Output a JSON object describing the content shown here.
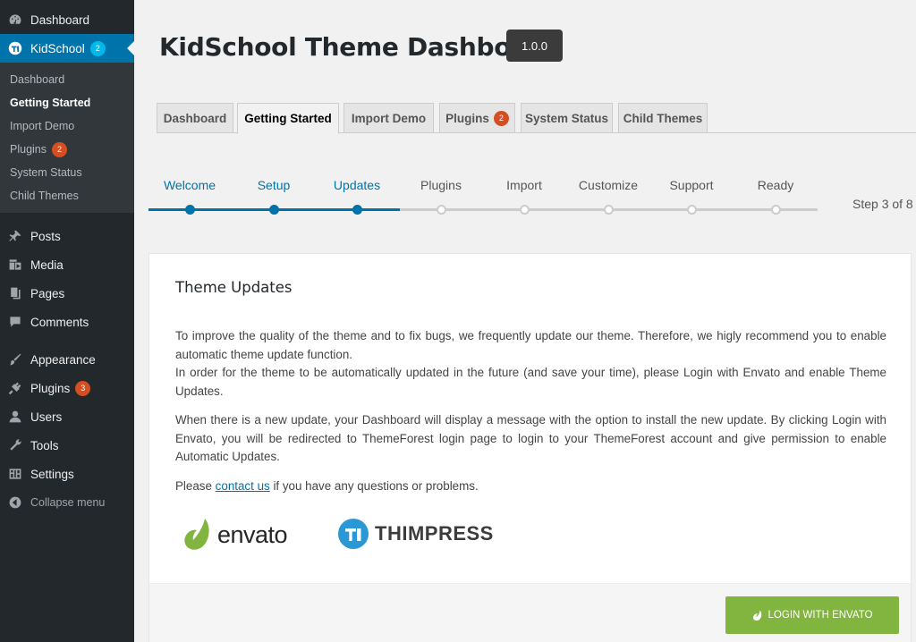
{
  "sidebar": {
    "items": [
      {
        "label": "Dashboard",
        "icon": "dashboard-icon"
      },
      {
        "label": "KidSchool",
        "icon": "thimpress-icon",
        "badge": "2"
      },
      {
        "label": "Posts",
        "icon": "pin-icon"
      },
      {
        "label": "Media",
        "icon": "media-icon"
      },
      {
        "label": "Pages",
        "icon": "pages-icon"
      },
      {
        "label": "Comments",
        "icon": "comments-icon"
      },
      {
        "label": "Appearance",
        "icon": "brush-icon"
      },
      {
        "label": "Plugins",
        "icon": "plugins-icon",
        "badge": "3"
      },
      {
        "label": "Users",
        "icon": "users-icon"
      },
      {
        "label": "Tools",
        "icon": "wrench-icon"
      },
      {
        "label": "Settings",
        "icon": "settings-icon"
      },
      {
        "label": "Collapse menu",
        "icon": "collapse-icon"
      }
    ],
    "submenu": [
      {
        "label": "Dashboard"
      },
      {
        "label": "Getting Started"
      },
      {
        "label": "Import Demo"
      },
      {
        "label": "Plugins",
        "badge": "2"
      },
      {
        "label": "System Status"
      },
      {
        "label": "Child Themes"
      }
    ]
  },
  "header": {
    "title": "KidSchool Theme Dashboard",
    "version": "1.0.0"
  },
  "tabs": [
    {
      "label": "Dashboard"
    },
    {
      "label": "Getting Started"
    },
    {
      "label": "Import Demo"
    },
    {
      "label": "Plugins",
      "badge": "2"
    },
    {
      "label": "System Status"
    },
    {
      "label": "Child Themes"
    }
  ],
  "steps": {
    "items": [
      "Welcome",
      "Setup",
      "Updates",
      "Plugins",
      "Import",
      "Customize",
      "Support",
      "Ready"
    ],
    "current": 3,
    "count_text": "Step 3 of 8"
  },
  "card": {
    "title": "Theme Updates",
    "para1_line1": "To improve the quality of the theme and to fix bugs, we frequently update our theme. Therefore, we higly recommend you to enable automatic theme update function.",
    "para1_line2": "In order for the theme to be automatically updated in the future (and save your time), please Login with Envato and enable Theme Updates.",
    "para2": "When there is a new update, your Dashboard will display a message with the option to install the new update. By clicking Login with Envato, you will be redirected to ThemeForest login page to login to your ThemeForest account and give permission to enable Automatic Updates.",
    "para3_pre": "Please ",
    "para3_link": "contact us",
    "para3_post": " if you have any questions or problems.",
    "envato_logo": "envato",
    "thimpress_logo": "THIMPRESS",
    "login_button": "LOGIN WITH ENVATO"
  },
  "colors": {
    "accent": "#0073aa",
    "sidebar_bg": "#23282d",
    "envato_green": "#82b440",
    "badge_red": "#d54e21"
  }
}
